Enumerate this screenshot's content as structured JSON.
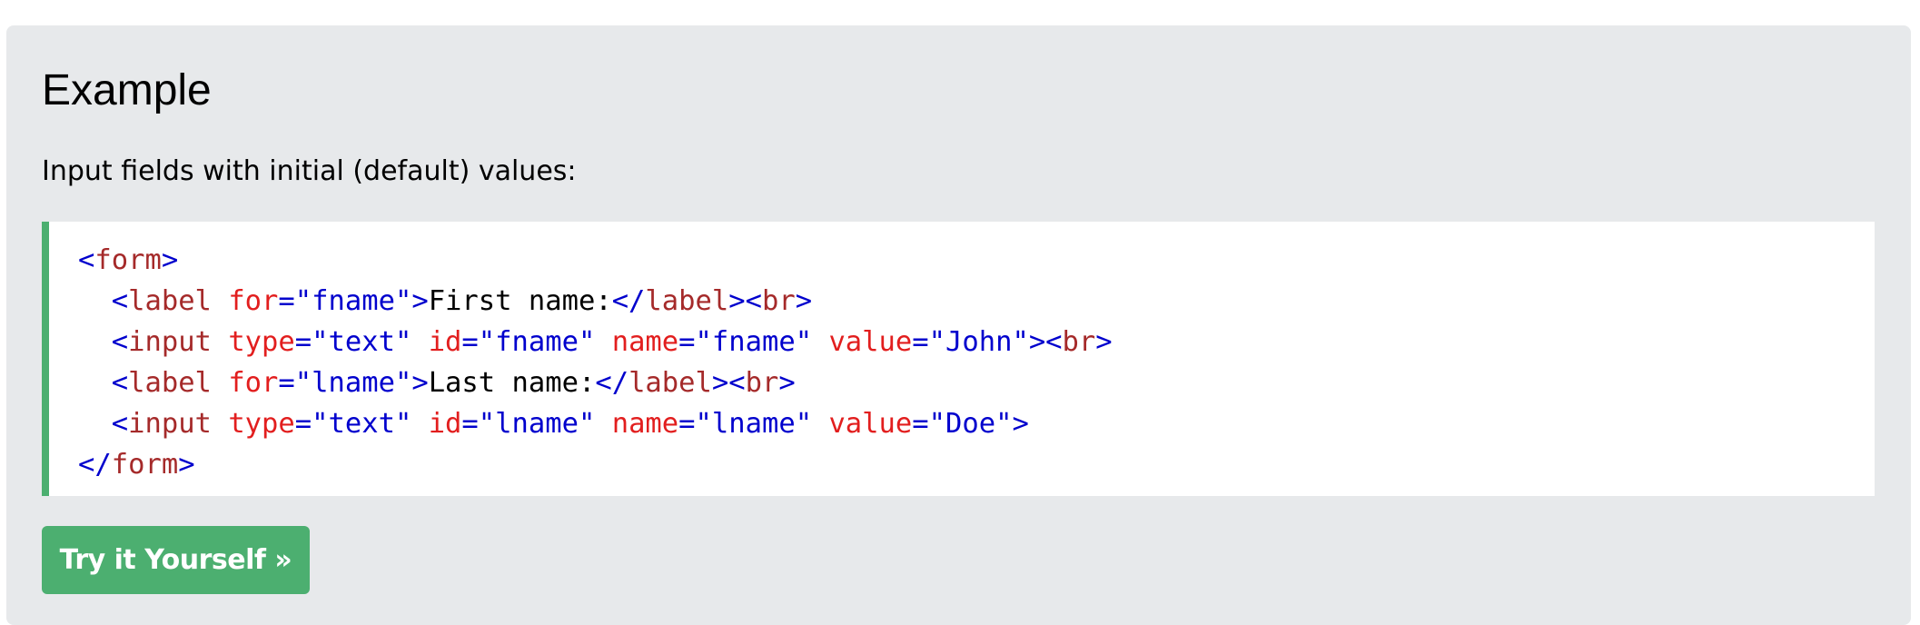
{
  "example": {
    "title": "Example",
    "intro": "Input fields with initial (default) values:",
    "code_lines": [
      [
        {
          "t": "bracket",
          "v": "<"
        },
        {
          "t": "tag",
          "v": "form"
        },
        {
          "t": "bracket",
          "v": ">"
        }
      ],
      [
        {
          "t": "text",
          "v": "  "
        },
        {
          "t": "bracket",
          "v": "<"
        },
        {
          "t": "tag",
          "v": "label"
        },
        {
          "t": "text",
          "v": " "
        },
        {
          "t": "attr",
          "v": "for"
        },
        {
          "t": "value",
          "v": "=\"fname\""
        },
        {
          "t": "bracket",
          "v": ">"
        },
        {
          "t": "text",
          "v": "First name:"
        },
        {
          "t": "bracket",
          "v": "</"
        },
        {
          "t": "tag",
          "v": "label"
        },
        {
          "t": "bracket",
          "v": "><"
        },
        {
          "t": "tag",
          "v": "br"
        },
        {
          "t": "bracket",
          "v": ">"
        }
      ],
      [
        {
          "t": "text",
          "v": "  "
        },
        {
          "t": "bracket",
          "v": "<"
        },
        {
          "t": "tag",
          "v": "input"
        },
        {
          "t": "text",
          "v": " "
        },
        {
          "t": "attr",
          "v": "type"
        },
        {
          "t": "value",
          "v": "=\"text\""
        },
        {
          "t": "text",
          "v": " "
        },
        {
          "t": "attr",
          "v": "id"
        },
        {
          "t": "value",
          "v": "=\"fname\""
        },
        {
          "t": "text",
          "v": " "
        },
        {
          "t": "attr",
          "v": "name"
        },
        {
          "t": "value",
          "v": "=\"fname\""
        },
        {
          "t": "text",
          "v": " "
        },
        {
          "t": "attr",
          "v": "value"
        },
        {
          "t": "value",
          "v": "=\"John\""
        },
        {
          "t": "bracket",
          "v": "><"
        },
        {
          "t": "tag",
          "v": "br"
        },
        {
          "t": "bracket",
          "v": ">"
        }
      ],
      [
        {
          "t": "text",
          "v": "  "
        },
        {
          "t": "bracket",
          "v": "<"
        },
        {
          "t": "tag",
          "v": "label"
        },
        {
          "t": "text",
          "v": " "
        },
        {
          "t": "attr",
          "v": "for"
        },
        {
          "t": "value",
          "v": "=\"lname\""
        },
        {
          "t": "bracket",
          "v": ">"
        },
        {
          "t": "text",
          "v": "Last name:"
        },
        {
          "t": "bracket",
          "v": "</"
        },
        {
          "t": "tag",
          "v": "label"
        },
        {
          "t": "bracket",
          "v": "><"
        },
        {
          "t": "tag",
          "v": "br"
        },
        {
          "t": "bracket",
          "v": ">"
        }
      ],
      [
        {
          "t": "text",
          "v": "  "
        },
        {
          "t": "bracket",
          "v": "<"
        },
        {
          "t": "tag",
          "v": "input"
        },
        {
          "t": "text",
          "v": " "
        },
        {
          "t": "attr",
          "v": "type"
        },
        {
          "t": "value",
          "v": "=\"text\""
        },
        {
          "t": "text",
          "v": " "
        },
        {
          "t": "attr",
          "v": "id"
        },
        {
          "t": "value",
          "v": "=\"lname\""
        },
        {
          "t": "text",
          "v": " "
        },
        {
          "t": "attr",
          "v": "name"
        },
        {
          "t": "value",
          "v": "=\"lname\""
        },
        {
          "t": "text",
          "v": " "
        },
        {
          "t": "attr",
          "v": "value"
        },
        {
          "t": "value",
          "v": "=\"Doe\""
        },
        {
          "t": "bracket",
          "v": ">"
        }
      ],
      [
        {
          "t": "bracket",
          "v": "</"
        },
        {
          "t": "tag",
          "v": "form"
        },
        {
          "t": "bracket",
          "v": ">"
        }
      ]
    ],
    "try_button_label": "Try it Yourself »"
  },
  "colors": {
    "panel_background": "#e7e9eb",
    "accent_green": "#4caf70",
    "code_tag": "#a52a2a",
    "code_attribute": "#e21e1e",
    "code_value": "#0000cd"
  }
}
